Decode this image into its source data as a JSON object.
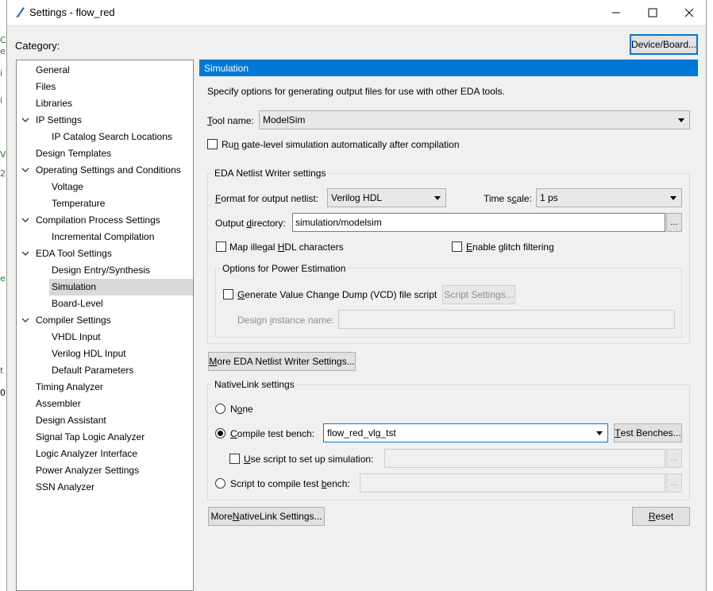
{
  "window": {
    "title": "Settings - flow_red",
    "minimize_icon": "minimize-icon",
    "maximize_icon": "maximize-icon",
    "close_icon": "close-icon"
  },
  "category_label": "Category:",
  "device_board_button": "Device/Board...",
  "tree": [
    {
      "label": "General",
      "level": 1,
      "expandable": false,
      "selected": false
    },
    {
      "label": "Files",
      "level": 1,
      "expandable": false,
      "selected": false
    },
    {
      "label": "Libraries",
      "level": 1,
      "expandable": false,
      "selected": false
    },
    {
      "label": "IP Settings",
      "level": 1,
      "expandable": true,
      "selected": false
    },
    {
      "label": "IP Catalog Search Locations",
      "level": 2,
      "expandable": false,
      "selected": false
    },
    {
      "label": "Design Templates",
      "level": 1,
      "expandable": false,
      "selected": false
    },
    {
      "label": "Operating Settings and Conditions",
      "level": 1,
      "expandable": true,
      "selected": false
    },
    {
      "label": "Voltage",
      "level": 2,
      "expandable": false,
      "selected": false
    },
    {
      "label": "Temperature",
      "level": 2,
      "expandable": false,
      "selected": false
    },
    {
      "label": "Compilation Process Settings",
      "level": 1,
      "expandable": true,
      "selected": false
    },
    {
      "label": "Incremental Compilation",
      "level": 2,
      "expandable": false,
      "selected": false
    },
    {
      "label": "EDA Tool Settings",
      "level": 1,
      "expandable": true,
      "selected": false
    },
    {
      "label": "Design Entry/Synthesis",
      "level": 2,
      "expandable": false,
      "selected": false
    },
    {
      "label": "Simulation",
      "level": 2,
      "expandable": false,
      "selected": true
    },
    {
      "label": "Board-Level",
      "level": 2,
      "expandable": false,
      "selected": false
    },
    {
      "label": "Compiler Settings",
      "level": 1,
      "expandable": true,
      "selected": false
    },
    {
      "label": "VHDL Input",
      "level": 2,
      "expandable": false,
      "selected": false
    },
    {
      "label": "Verilog HDL Input",
      "level": 2,
      "expandable": false,
      "selected": false
    },
    {
      "label": "Default Parameters",
      "level": 2,
      "expandable": false,
      "selected": false
    },
    {
      "label": "Timing Analyzer",
      "level": 1,
      "expandable": false,
      "selected": false
    },
    {
      "label": "Assembler",
      "level": 1,
      "expandable": false,
      "selected": false
    },
    {
      "label": "Design Assistant",
      "level": 1,
      "expandable": false,
      "selected": false
    },
    {
      "label": "Signal Tap Logic Analyzer",
      "level": 1,
      "expandable": false,
      "selected": false
    },
    {
      "label": "Logic Analyzer Interface",
      "level": 1,
      "expandable": false,
      "selected": false
    },
    {
      "label": "Power Analyzer Settings",
      "level": 1,
      "expandable": false,
      "selected": false
    },
    {
      "label": "SSN Analyzer",
      "level": 1,
      "expandable": false,
      "selected": false
    }
  ],
  "panel": {
    "header": "Simulation",
    "description": "Specify options for generating output files for use with other EDA tools.",
    "tool_name_label_pre": "",
    "tool_name_label_key": "T",
    "tool_name_label_post": "ool name:",
    "tool_name_value": "ModelSim",
    "run_gate_pre": "Ru",
    "run_gate_key": "n",
    "run_gate_post": " gate-level simulation automatically after compilation",
    "eda_netlist_group": "EDA Netlist Writer settings",
    "format_label_pre": "",
    "format_label_key": "F",
    "format_label_post": "ormat for output netlist:",
    "format_value": "Verilog HDL",
    "time_scale_pre": "Time s",
    "time_scale_key": "c",
    "time_scale_post": "ale:",
    "time_scale_value": "1 ps",
    "output_dir_pre": "Output ",
    "output_dir_key": "d",
    "output_dir_post": "irectory:",
    "output_dir_value": "simulation/modelsim",
    "browse_label": "...",
    "map_illegal_pre": "Map illegal ",
    "map_illegal_key": "H",
    "map_illegal_post": "DL characters",
    "glitch_pre": "",
    "glitch_key": "E",
    "glitch_post": "nable glitch filtering",
    "power_group": "Options for Power Estimation",
    "vcd_pre": "",
    "vcd_key": "G",
    "vcd_post": "enerate Value Change Dump (VCD) file script",
    "script_settings": "Script Settings...",
    "design_instance_pre": "Design ",
    "design_instance_key": "i",
    "design_instance_post": "nstance name:",
    "more_eda_pre": "",
    "more_eda_key": "M",
    "more_eda_post": "ore EDA Netlist Writer Settings...",
    "nativelink_group": "NativeLink settings",
    "none_pre": "N",
    "none_key": "o",
    "none_post": "ne",
    "compile_tb_pre": "",
    "compile_tb_key": "C",
    "compile_tb_post": "ompile test bench:",
    "compile_tb_value": "flow_red_vlg_tst",
    "test_benches_pre": "",
    "test_benches_key": "T",
    "test_benches_post": "est Benches...",
    "use_script_pre": "",
    "use_script_key": "U",
    "use_script_post": "se script to set up simulation:",
    "script_compile_pre": "Script to compile test ",
    "script_compile_key": "b",
    "script_compile_post": "ench:",
    "more_native_pre": "More ",
    "more_native_key": "N",
    "more_native_post": "ativeLink Settings...",
    "reset_pre": "",
    "reset_key": "R",
    "reset_post": "eset"
  }
}
